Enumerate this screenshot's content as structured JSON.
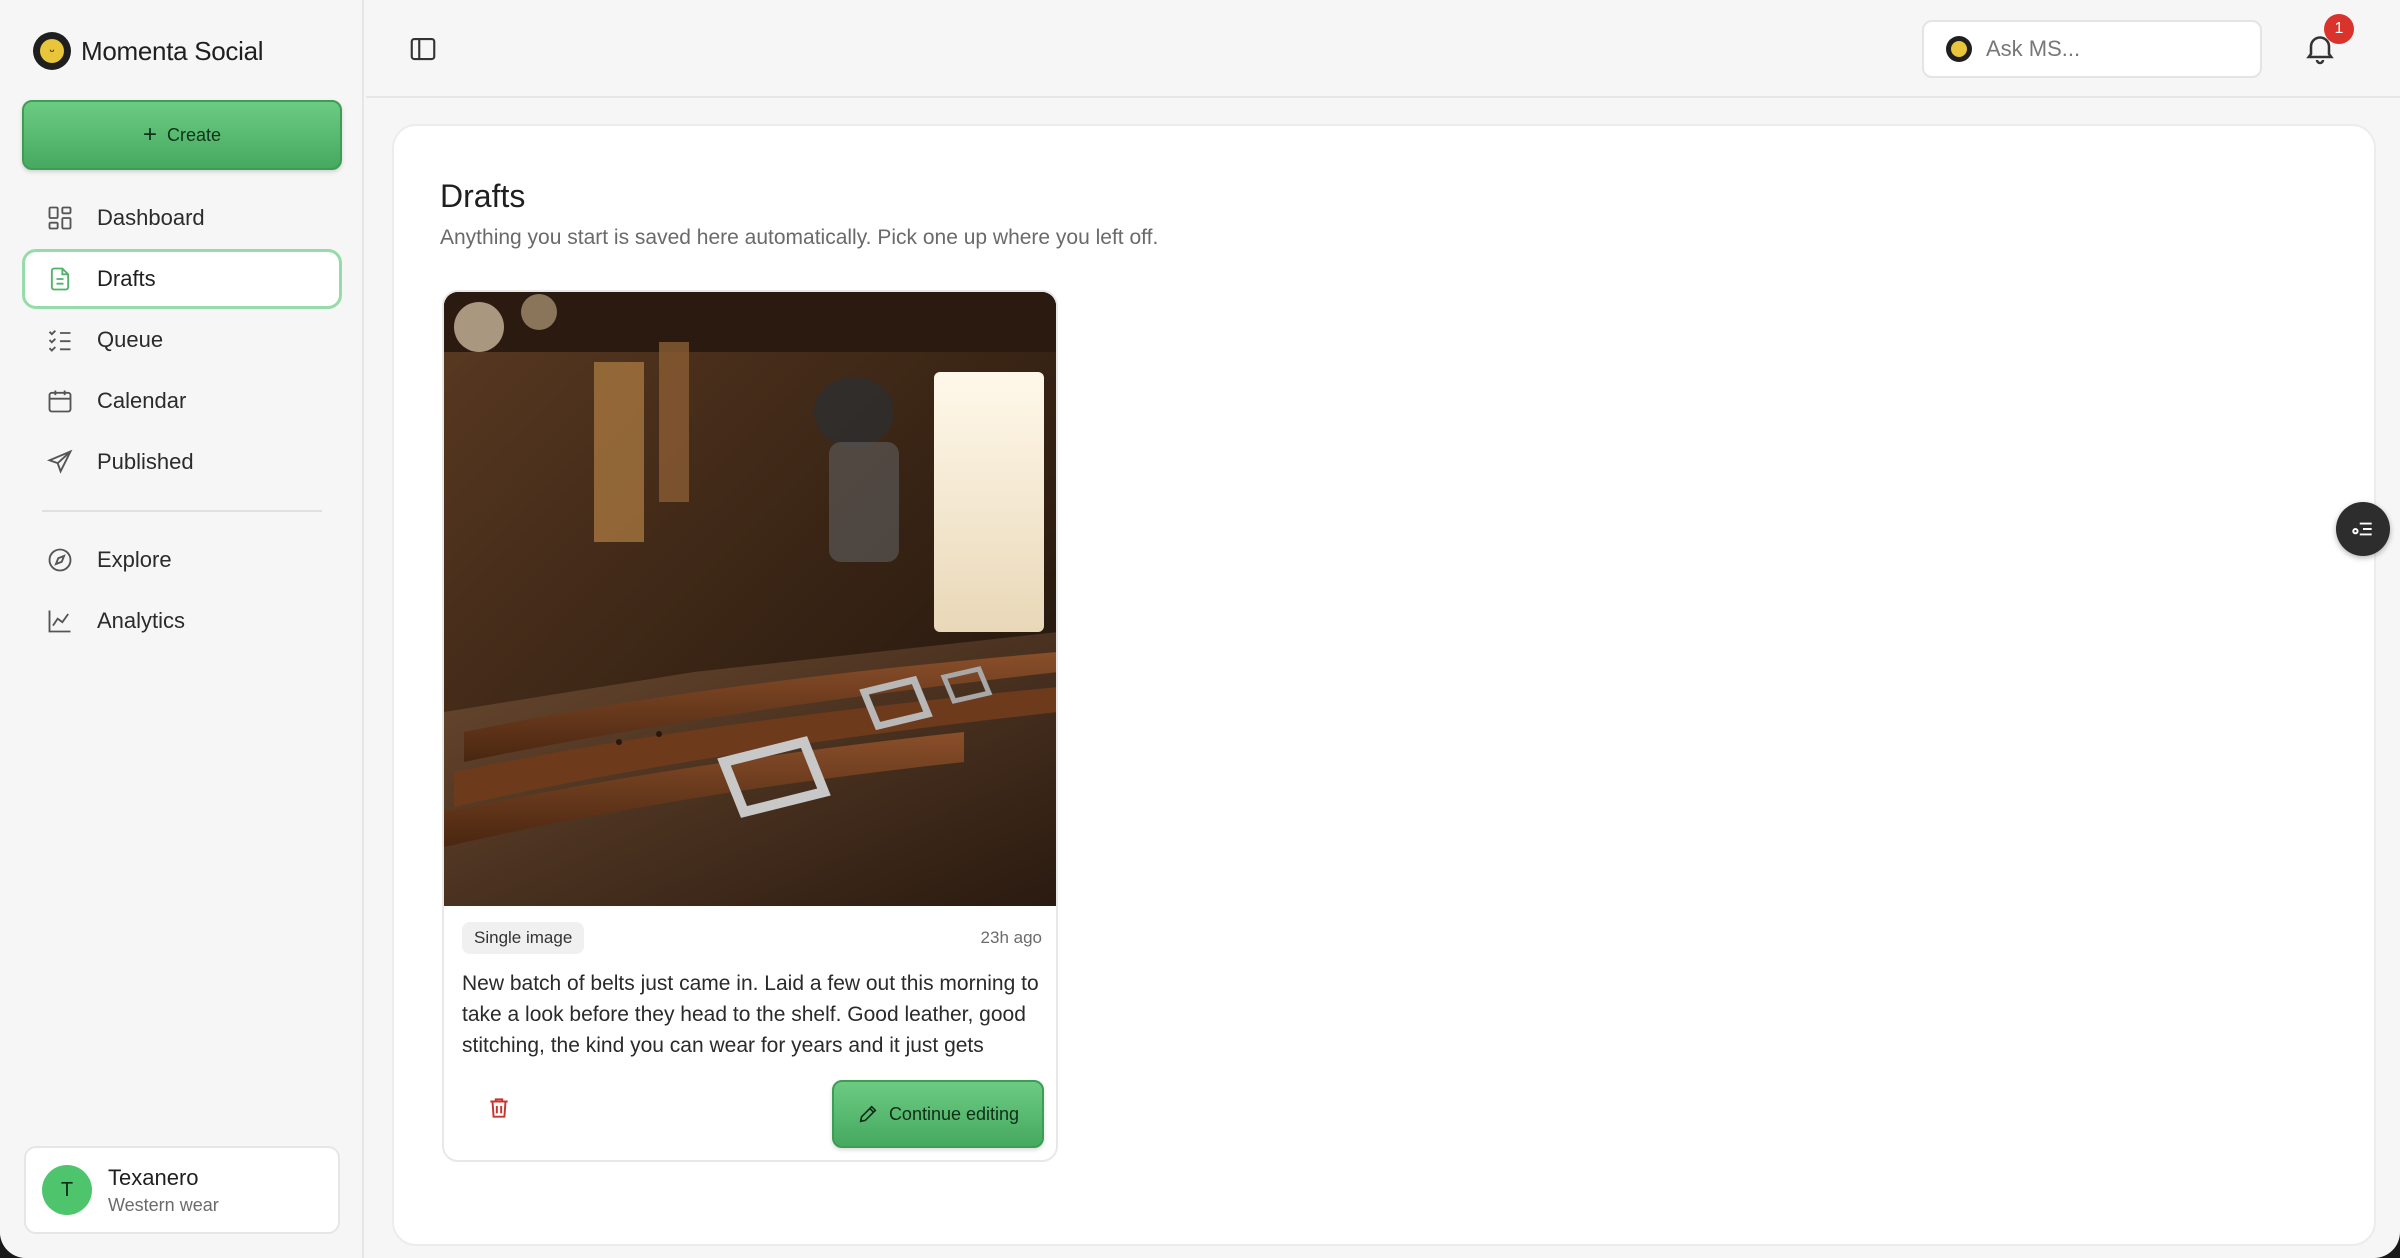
{
  "app": {
    "name": "Momenta Social"
  },
  "sidebar": {
    "create_label": "Create",
    "items": [
      {
        "label": "Dashboard",
        "icon": "dashboard-icon"
      },
      {
        "label": "Drafts",
        "icon": "document-icon",
        "active": true
      },
      {
        "label": "Queue",
        "icon": "checklist-icon"
      },
      {
        "label": "Calendar",
        "icon": "calendar-icon"
      },
      {
        "label": "Published",
        "icon": "send-icon"
      },
      {
        "label": "Explore",
        "icon": "compass-icon"
      },
      {
        "label": "Analytics",
        "icon": "chart-line-icon"
      }
    ],
    "user": {
      "initial": "T",
      "name": "Texanero",
      "subtitle": "Western wear"
    }
  },
  "topbar": {
    "ask_placeholder": "Ask MS...",
    "notification_count": "1"
  },
  "main": {
    "title": "Drafts",
    "subtitle": "Anything you start is saved here automatically. Pick one up where you left off.",
    "drafts": [
      {
        "type": "Single image",
        "time": "23h ago",
        "text": "New batch of belts just came in. Laid a few out this morning to take a look before they head to the shelf. Good leather, good stitching, the kind you can wear for years and it just gets better...",
        "continue_label": "Continue editing"
      }
    ]
  },
  "colors": {
    "accent_green": "#4fb368",
    "active_border": "#96dcaa",
    "badge_red": "#d9332b",
    "delete_red": "#c8352c"
  }
}
